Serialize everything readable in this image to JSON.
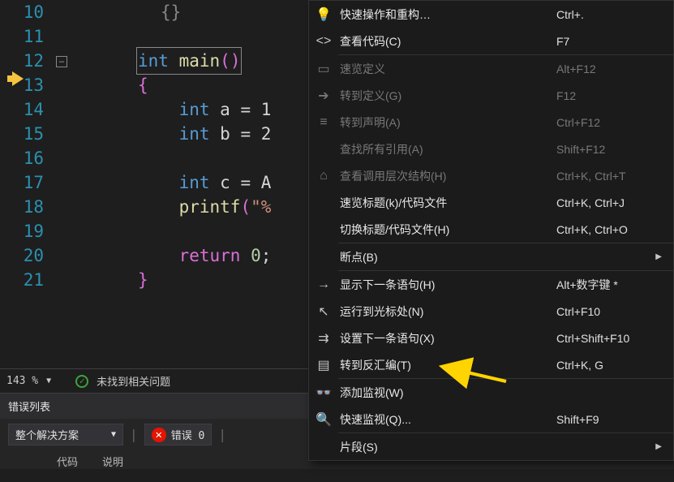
{
  "editor": {
    "lines": [
      "10",
      "11",
      "12",
      "13",
      "14",
      "15",
      "16",
      "17",
      "18",
      "19",
      "20",
      "21"
    ],
    "empty_braces": "{}",
    "decl_int": "int",
    "main": "main",
    "paren_open": "(",
    "paren_close": ")",
    "brace_open": "{",
    "brace_close": "}",
    "var_a": "a = 1",
    "semi": ";",
    "var_b": "b = 2",
    "var_c": "c = A",
    "printf": "printf",
    "qopen": "(",
    "quote": "\"%",
    "ret": "return",
    "zero": "0",
    "fold_minus": "−"
  },
  "status": {
    "zoom": "143 %",
    "no_issues": "未找到相关问题"
  },
  "panel": {
    "title": "错误列表",
    "scope": "整个解决方案",
    "err_label": "错误 0",
    "col_code": "代码",
    "col_desc": "说明"
  },
  "menu": [
    {
      "icon": "bulb",
      "label": "快速操作和重构…",
      "short": "Ctrl+.",
      "disabled": false
    },
    {
      "icon": "code",
      "label": "查看代码(C)",
      "short": "F7",
      "disabled": false
    },
    {
      "sep": true
    },
    {
      "icon": "doc",
      "label": "速览定义",
      "short": "Alt+F12",
      "disabled": true
    },
    {
      "icon": "goto",
      "label": "转到定义(G)",
      "short": "F12",
      "disabled": true
    },
    {
      "icon": "decl",
      "label": "转到声明(A)",
      "short": "Ctrl+F12",
      "disabled": true
    },
    {
      "icon": "",
      "label": "查找所有引用(A)",
      "short": "Shift+F12",
      "disabled": true
    },
    {
      "icon": "hier",
      "label": "查看调用层次结构(H)",
      "short": "Ctrl+K, Ctrl+T",
      "disabled": true
    },
    {
      "icon": "",
      "label": "速览标题(k)/代码文件",
      "short": "Ctrl+K, Ctrl+J",
      "disabled": false
    },
    {
      "icon": "",
      "label": "切换标题/代码文件(H)",
      "short": "Ctrl+K, Ctrl+O",
      "disabled": false
    },
    {
      "sep": true
    },
    {
      "icon": "",
      "label": "断点(B)",
      "short": "",
      "sub": true,
      "disabled": false
    },
    {
      "sep": true
    },
    {
      "icon": "arrow",
      "label": "显示下一条语句(H)",
      "short": "Alt+数字键 *",
      "disabled": false
    },
    {
      "icon": "cursor",
      "label": "运行到光标处(N)",
      "short": "Ctrl+F10",
      "disabled": false
    },
    {
      "icon": "set",
      "label": "设置下一条语句(X)",
      "short": "Ctrl+Shift+F10",
      "disabled": false
    },
    {
      "icon": "dis",
      "label": "转到反汇编(T)",
      "short": "Ctrl+K, G",
      "disabled": false
    },
    {
      "sep": true
    },
    {
      "icon": "watch",
      "label": "添加监视(W)",
      "short": "",
      "disabled": false
    },
    {
      "icon": "quick",
      "label": "快速监视(Q)...",
      "short": "Shift+F9",
      "disabled": false
    },
    {
      "sep": true
    },
    {
      "icon": "",
      "label": "片段(S)",
      "short": "",
      "sub": true,
      "disabled": false
    }
  ]
}
